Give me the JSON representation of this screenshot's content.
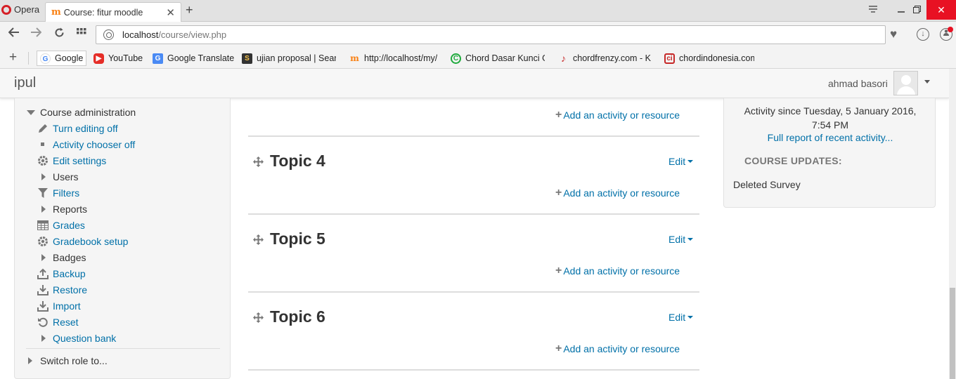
{
  "browser": {
    "menu_label": "Opera",
    "tab_title": "Course: fitur moodle",
    "url_host": "localhost",
    "url_path": "/course/view.php",
    "bookmarks": [
      {
        "label": "Google"
      },
      {
        "label": "YouTube"
      },
      {
        "label": "Google Translate"
      },
      {
        "label": "ujian proposal | Searc"
      },
      {
        "label": "http://localhost/my/"
      },
      {
        "label": "Chord Dasar Kunci Gi"
      },
      {
        "label": "chordfrenzy.com - Ko"
      },
      {
        "label": "chordindonesia.com"
      }
    ]
  },
  "header": {
    "site_name": "ipul",
    "user_name": "ahmad basori"
  },
  "admin": {
    "heading": "Course administration",
    "items": [
      {
        "label": "Turn editing off",
        "icon": "pencil-icon"
      },
      {
        "label": "Activity chooser off",
        "icon": "bullet-icon"
      },
      {
        "label": "Edit settings",
        "icon": "gear-icon"
      },
      {
        "label": "Users",
        "icon": "expand-arrow-icon"
      },
      {
        "label": "Filters",
        "icon": "filter-icon"
      },
      {
        "label": "Reports",
        "icon": "expand-arrow-icon"
      },
      {
        "label": "Grades",
        "icon": "grades-table-icon"
      },
      {
        "label": "Gradebook setup",
        "icon": "gear-icon"
      },
      {
        "label": "Badges",
        "icon": "expand-arrow-icon"
      },
      {
        "label": "Backup",
        "icon": "upload-icon"
      },
      {
        "label": "Restore",
        "icon": "download-icon"
      },
      {
        "label": "Import",
        "icon": "download-icon"
      },
      {
        "label": "Reset",
        "icon": "reset-icon"
      },
      {
        "label": "Question bank",
        "icon": "expand-arrow-icon"
      }
    ],
    "switch_role": "Switch role to..."
  },
  "main": {
    "add_activity_label": "Add an activity or resource",
    "edit_label": "Edit",
    "topics": [
      {
        "title": "Topic 4"
      },
      {
        "title": "Topic 5"
      },
      {
        "title": "Topic 6"
      }
    ]
  },
  "recent": {
    "activity_since_line1": "Activity since Tuesday, 5 January 2016,",
    "activity_since_line2": "7:54 PM",
    "full_report": "Full report of recent activity...",
    "course_updates_heading": "COURSE UPDATES:",
    "update_item": "Deleted Survey"
  },
  "colors": {
    "link": "#0070a8",
    "opera_red": "#d51f26",
    "moodle_orange": "#f98012"
  }
}
